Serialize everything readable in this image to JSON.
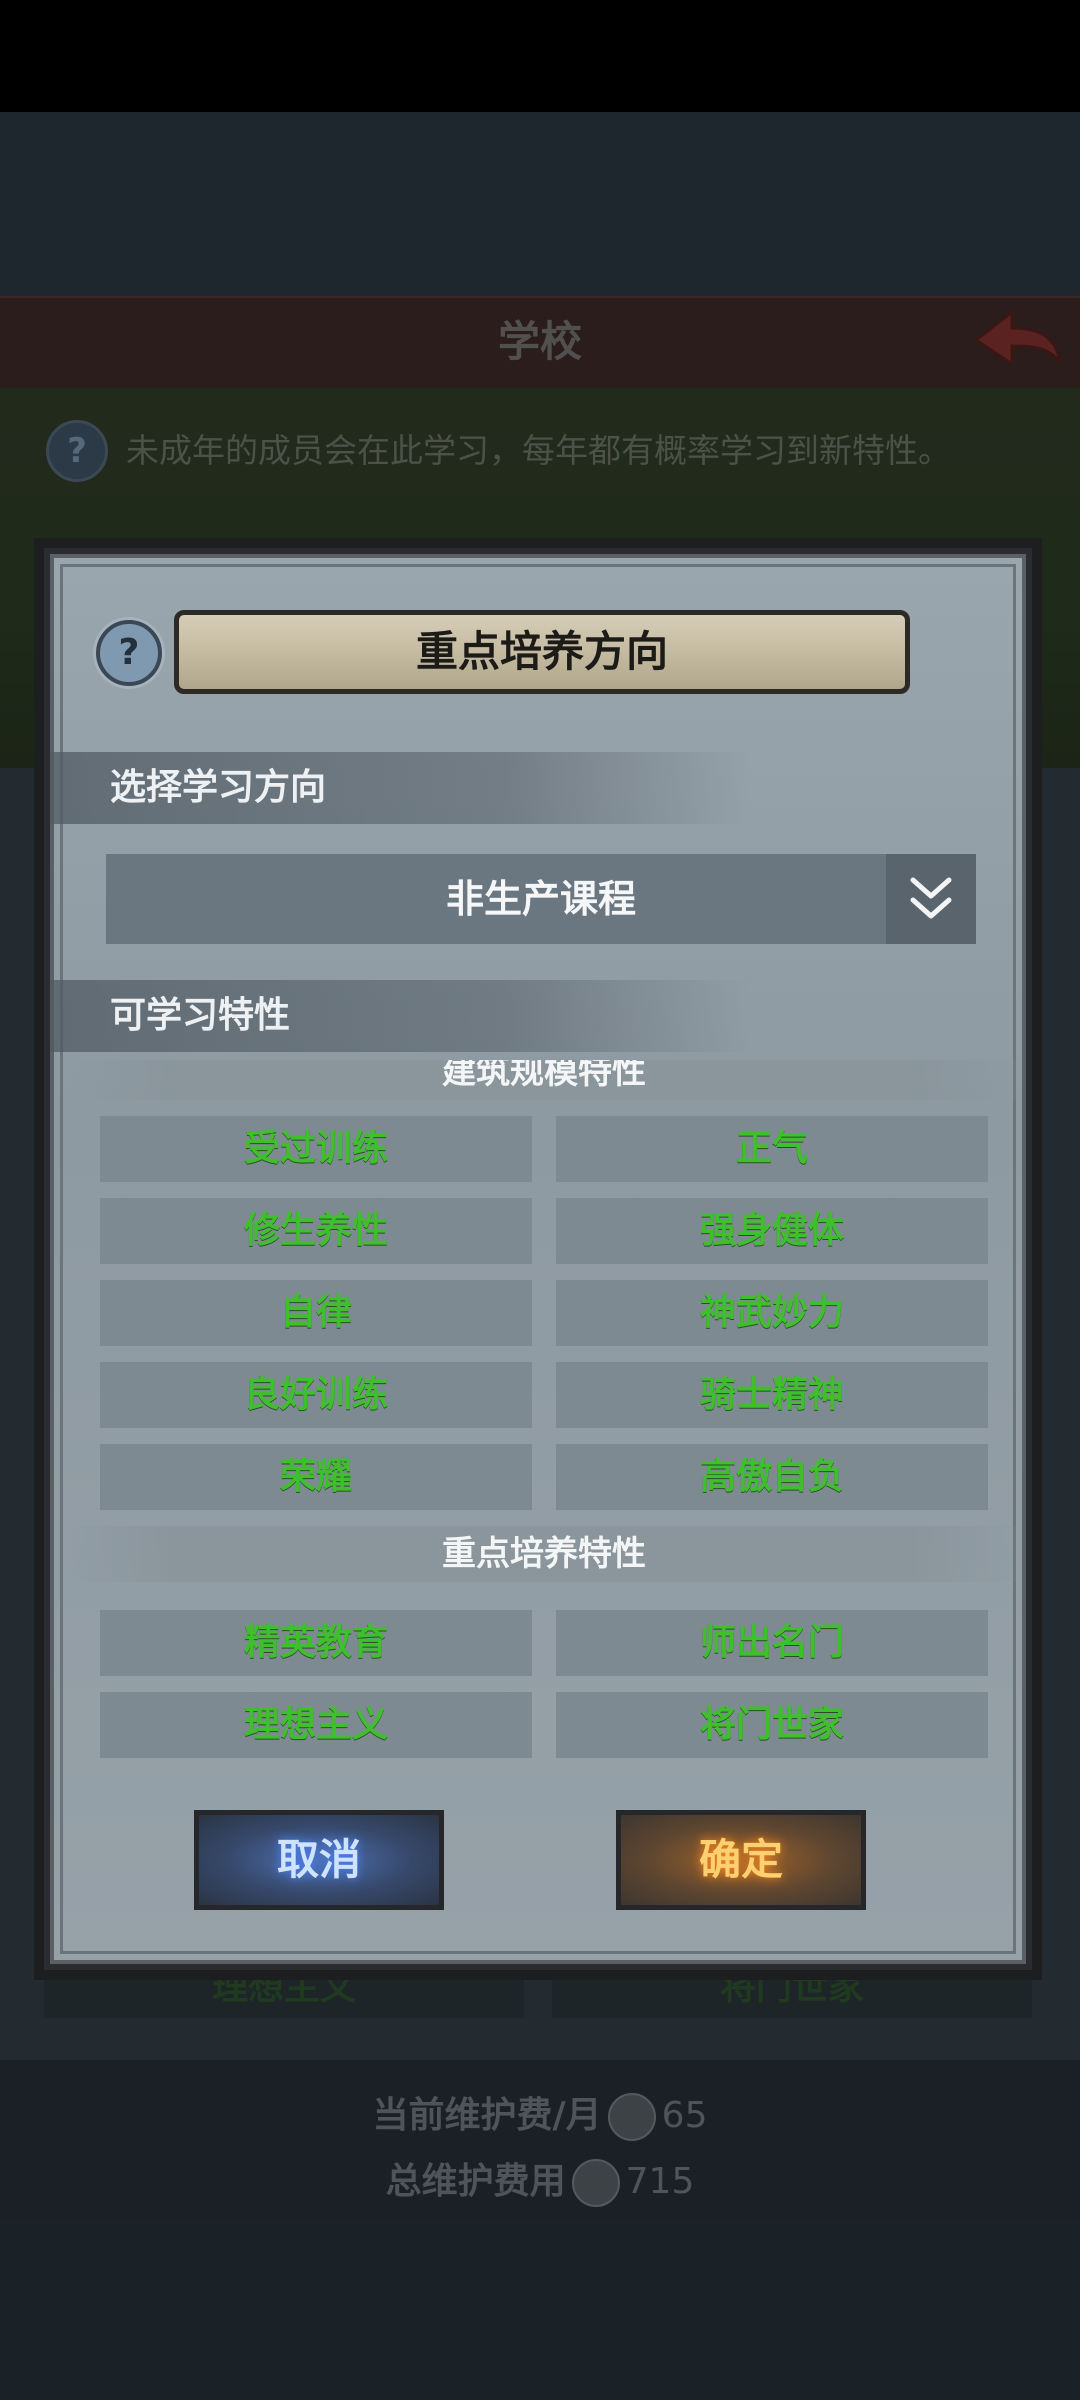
{
  "background": {
    "title": "学校",
    "info_text": "未成年的成员会在此学习，每年都有概率学习到新特性。",
    "info_icon": "?",
    "ghost_traits": [
      "理想主义",
      "将门世家"
    ],
    "fees": {
      "monthly_label": "当前维护费/月",
      "monthly_value": "65",
      "total_label": "总维护费用",
      "total_value": "715"
    }
  },
  "dialog": {
    "help_icon": "?",
    "title": "重点培养方向",
    "direction_label": "选择学习方向",
    "dropdown_value": "非生产课程",
    "traits_label": "可学习特性",
    "categories": [
      {
        "name": "建筑规模特性",
        "traits": [
          "受过训练",
          "正气",
          "修生养性",
          "强身健体",
          "自律",
          "神武妙力",
          "良好训练",
          "骑士精神",
          "荣耀",
          "高傲自负"
        ]
      },
      {
        "name": "重点培养特性",
        "traits": [
          "精英教育",
          "师出名门",
          "理想主义",
          "将门世家"
        ]
      }
    ],
    "cancel_label": "取消",
    "confirm_label": "确定"
  },
  "colors": {
    "trait_text": "#3fbf2e",
    "cancel_glow": "#4b86ff",
    "confirm_glow": "#ff8a20"
  }
}
